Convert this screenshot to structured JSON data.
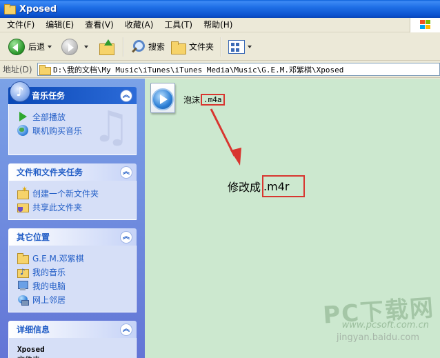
{
  "window": {
    "title": "Xposed"
  },
  "menu": {
    "items": [
      {
        "label": "文件(F)"
      },
      {
        "label": "编辑(E)"
      },
      {
        "label": "查看(V)"
      },
      {
        "label": "收藏(A)"
      },
      {
        "label": "工具(T)"
      },
      {
        "label": "帮助(H)"
      }
    ]
  },
  "toolbar": {
    "back_label": "后退",
    "search_label": "搜索",
    "folders_label": "文件夹"
  },
  "address": {
    "label": "地址(D)",
    "path": "D:\\我的文档\\My Music\\iTunes\\iTunes Media\\Music\\G.E.M.邓紫棋\\Xposed"
  },
  "sidebar": {
    "music_tasks": {
      "title": "音乐任务",
      "items": [
        {
          "label": "全部播放",
          "icon": "play-icon"
        },
        {
          "label": "联机购买音乐",
          "icon": "globe-icon"
        }
      ]
    },
    "file_tasks": {
      "title": "文件和文件夹任务",
      "items": [
        {
          "label": "创建一个新文件夹",
          "icon": "new-folder-icon"
        },
        {
          "label": "共享此文件夹",
          "icon": "share-folder-icon"
        }
      ]
    },
    "other_places": {
      "title": "其它位置",
      "items": [
        {
          "label": "G.E.M.邓紫棋",
          "icon": "folder-icon"
        },
        {
          "label": "我的音乐",
          "icon": "my-music-icon"
        },
        {
          "label": "我的电脑",
          "icon": "my-computer-icon"
        },
        {
          "label": "网上邻居",
          "icon": "network-icon"
        }
      ]
    },
    "details": {
      "title": "详细信息",
      "name": "Xposed",
      "type": "文件夹"
    }
  },
  "files": [
    {
      "stem": "泡沫",
      "ext": ".m4a",
      "icon": "windows-media-file-icon"
    }
  ],
  "annotation": {
    "text": "修改成",
    "ext": ".m4r",
    "color": "#d8352f"
  },
  "watermark": {
    "brand": "PC下载网",
    "url": "www.pcsoft.com.cn",
    "source": "jingyan.baidu.com"
  }
}
